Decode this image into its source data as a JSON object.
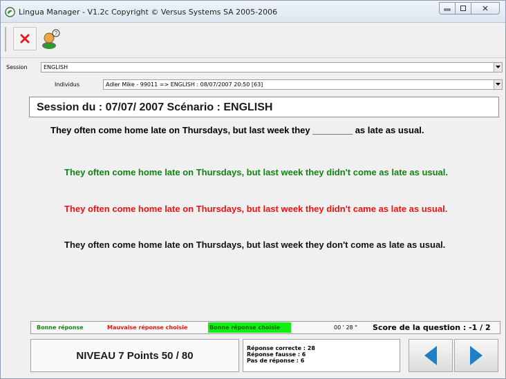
{
  "window": {
    "title": "Lingua Manager - V1.2c Copyright © Versus Systems SA 2005-2006"
  },
  "session_row": {
    "label": "Session",
    "value": "ENGLISH"
  },
  "individual_row": {
    "label": "Individus",
    "value": "Adler Mike - 99011 => ENGLISH : 08/07/2007 20:50 [63]"
  },
  "session_header": "Session du : 07/07/ 2007 Scénario : ENGLISH",
  "question": "They often come home late on Thursdays, but last week they ________ as late as usual.",
  "answers": [
    {
      "text": "They often come home late on Thursdays, but last week they didn't come as late as usual.",
      "color": "#128212"
    },
    {
      "text": "They often come home late on Thursdays, but last week they didn't came as late as usual.",
      "color": "#ee1111"
    },
    {
      "text": "They often come home late on Thursdays, but last week they don't come as late as usual.",
      "color": "#111111"
    }
  ],
  "legend": {
    "good": "Bonne réponse",
    "bad": "Mauvaise réponse choisie",
    "chosen": "Bonne réponse choisie",
    "timer": "00 ' 28 \"",
    "score": "Score de la question : -1 / 2"
  },
  "level": "NIVEAU 7 Points 50 / 80",
  "stats": {
    "correct": "Réponse correcte : 28",
    "wrong": "Réponse fausse : 6",
    "none": "Pas de réponse : 6"
  },
  "colors": {
    "correct": "#128212",
    "wrong": "#ee1111",
    "chosen_bg": "#11ee11",
    "arrow": "#1e7fc4"
  }
}
